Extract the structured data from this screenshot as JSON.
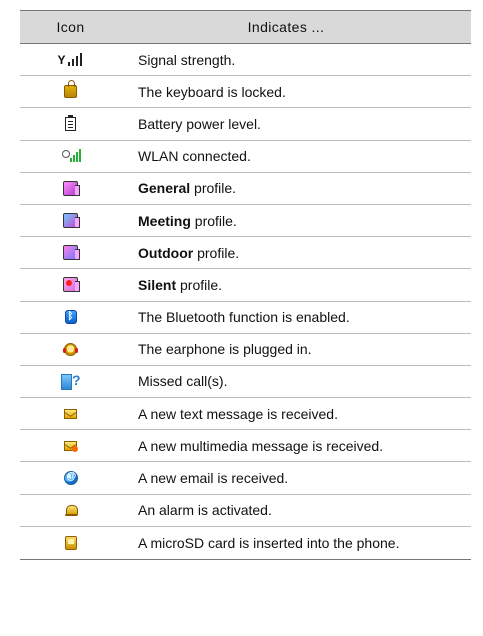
{
  "table": {
    "header": {
      "icon": "Icon",
      "indicates": "Indicates ..."
    },
    "rows": [
      {
        "icon": "signal-strength-icon",
        "text": "Signal strength."
      },
      {
        "icon": "keyboard-lock-icon",
        "text": "The keyboard is locked."
      },
      {
        "icon": "battery-icon",
        "text": "Battery power level."
      },
      {
        "icon": "wlan-icon",
        "text": "WLAN connected."
      },
      {
        "icon": "general-profile-icon",
        "bold": "General",
        "text": " profile."
      },
      {
        "icon": "meeting-profile-icon",
        "bold": "Meeting",
        "text": " profile."
      },
      {
        "icon": "outdoor-profile-icon",
        "bold": "Outdoor",
        "text": " profile."
      },
      {
        "icon": "silent-profile-icon",
        "bold": "Silent",
        "text": " profile."
      },
      {
        "icon": "bluetooth-icon",
        "text": "The Bluetooth function is enabled."
      },
      {
        "icon": "earphone-icon",
        "text": "The earphone is plugged in."
      },
      {
        "icon": "missed-call-icon",
        "text": "Missed call(s)."
      },
      {
        "icon": "text-message-icon",
        "text": "A new text message is received."
      },
      {
        "icon": "multimedia-message-icon",
        "text": "A new multimedia message is received."
      },
      {
        "icon": "email-icon",
        "text": "A new email is received."
      },
      {
        "icon": "alarm-icon",
        "text": "An alarm is activated."
      },
      {
        "icon": "microsd-card-icon",
        "text": "A microSD card is inserted into the phone."
      }
    ]
  }
}
